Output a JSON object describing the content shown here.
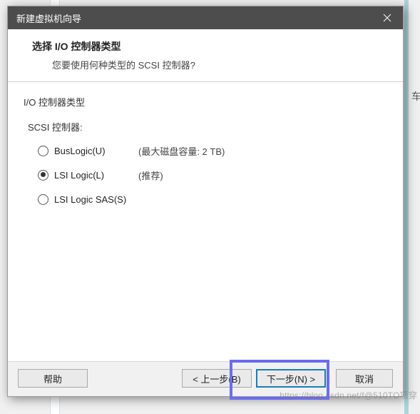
{
  "titlebar": {
    "title": "新建虚拟机向导"
  },
  "header": {
    "title": "选择 I/O 控制器类型",
    "subtitle": "您要使用何种类型的 SCSI 控制器?"
  },
  "content": {
    "section_label": "I/O 控制器类型",
    "sub_label": "SCSI 控制器:",
    "options": [
      {
        "label": "BusLogic(U)",
        "note": "(最大磁盘容量: 2 TB)",
        "selected": false
      },
      {
        "label": "LSI Logic(L)",
        "note": "(推荐)",
        "selected": true
      },
      {
        "label": "LSI Logic SAS(S)",
        "note": "",
        "selected": false
      }
    ]
  },
  "footer": {
    "help": "帮助",
    "back": "< 上一步(B)",
    "next": "下一步(N) >",
    "cancel": "取消"
  },
  "bg_char": "车",
  "watermark": "https://blog.csdn.net/f@510TO项穿"
}
